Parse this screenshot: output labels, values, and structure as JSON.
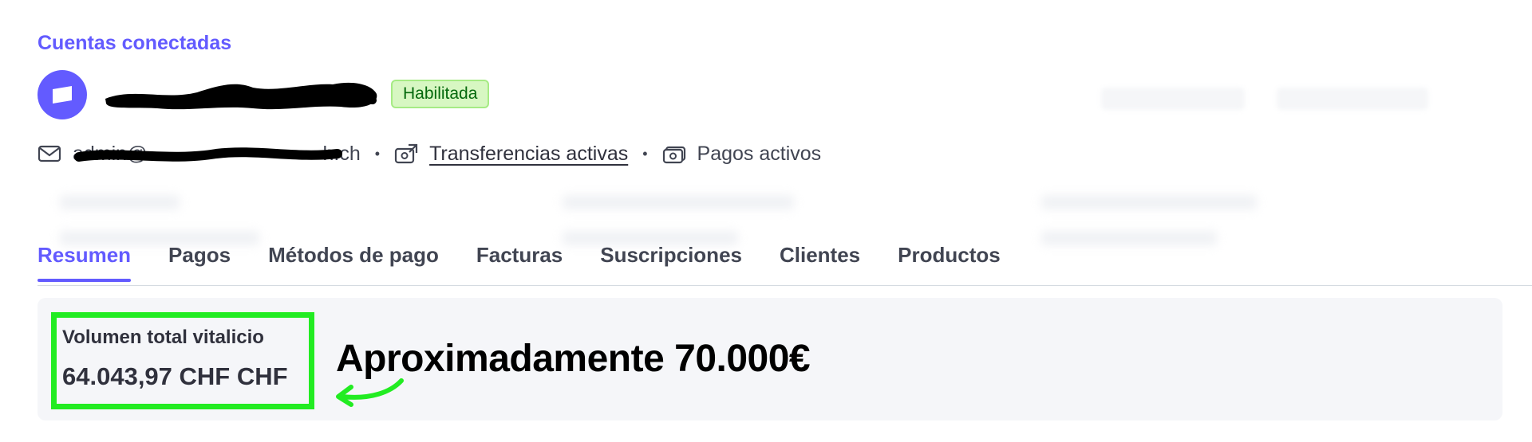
{
  "breadcrumb": {
    "label": "Cuentas conectadas"
  },
  "account": {
    "status_badge": "Habilitada"
  },
  "meta": {
    "email": "admin@",
    "email_suffix": "h.ch",
    "separator": "•",
    "transfers_label": "Transferencias activas",
    "payments_label": "Pagos activos"
  },
  "tabs": [
    {
      "label": "Resumen",
      "active": true
    },
    {
      "label": "Pagos"
    },
    {
      "label": "Métodos de pago"
    },
    {
      "label": "Facturas"
    },
    {
      "label": "Suscripciones"
    },
    {
      "label": "Clientes"
    },
    {
      "label": "Productos"
    }
  ],
  "summary": {
    "lifetime_volume_label": "Volumen total vitalicio",
    "lifetime_volume_value": "64.043,97 CHF CHF"
  },
  "annotation": {
    "text": "Aproximadamente 70.000€",
    "highlight_color": "#22ec22"
  },
  "colors": {
    "accent": "#635bff",
    "badge_bg": "#d7f7c2",
    "badge_text": "#05690d"
  }
}
